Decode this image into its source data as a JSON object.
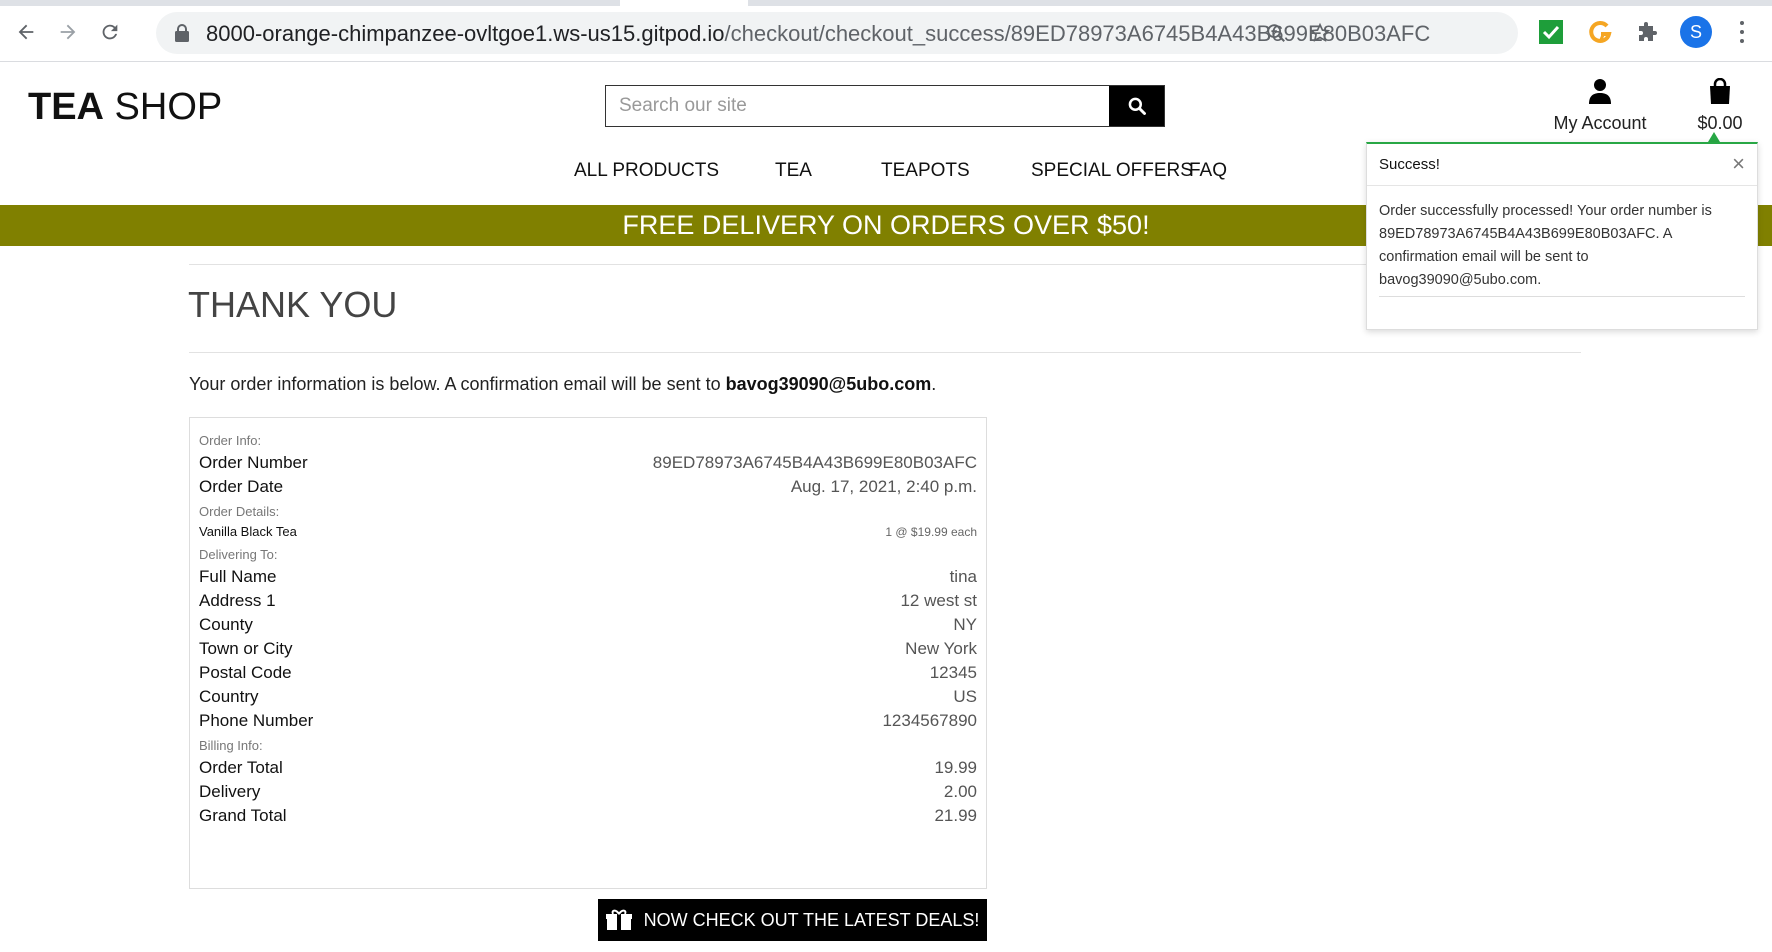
{
  "browser": {
    "url_host": "8000-orange-chimpanzee-ovltgoe1.ws-us15.gitpod.io",
    "url_path": "/checkout/checkout_success/89ED78973A6745B4A43B699E80B03AFC",
    "profile_initial": "S",
    "icons": [
      "back-icon",
      "forward-icon",
      "reload-icon",
      "lock-icon",
      "zoom-icon",
      "star-icon",
      "check-extension-icon",
      "grammarly-extension-icon",
      "puzzle-extension-icon",
      "more-icon"
    ]
  },
  "header": {
    "logo_bold": "TEA",
    "logo_rest": " SHOP",
    "search_placeholder": "Search our site",
    "account_label": "My Account",
    "bag_total": "$0.00"
  },
  "nav": {
    "items": [
      "ALL PRODUCTS",
      "TEA",
      "TEAPOTS",
      "SPECIAL OFFERS",
      "FAQ"
    ]
  },
  "banner": {
    "text": "FREE DELIVERY ON ORDERS OVER $50!",
    "color": "#808000"
  },
  "page": {
    "title": "THANK YOU",
    "intro_prefix": "Your order information is below. A confirmation email will be sent to ",
    "intro_email": "bavog39090@5ubo.com",
    "intro_suffix": "."
  },
  "order": {
    "info_label": "Order Info:",
    "number_label": "Order Number",
    "number": "89ED78973A6745B4A43B699E80B03AFC",
    "date_label": "Order Date",
    "date": "Aug. 17, 2021, 2:40 p.m.",
    "details_label": "Order Details:",
    "item_name": "Vanilla Black Tea",
    "item_qty": "1 @ $19.99 each",
    "delivering_label": "Delivering To:",
    "full_name_label": "Full Name",
    "full_name": "tina",
    "address1_label": "Address 1",
    "address1": "12 west st",
    "county_label": "County",
    "county": "NY",
    "town_label": "Town or City",
    "town": "New York",
    "postal_label": "Postal Code",
    "postal": "12345",
    "country_label": "Country",
    "country": "US",
    "phone_label": "Phone Number",
    "phone": "1234567890",
    "billing_label": "Billing Info:",
    "order_total_label": "Order Total",
    "order_total": "19.99",
    "delivery_label": "Delivery",
    "delivery": "2.00",
    "grand_total_label": "Grand Total",
    "grand_total": "21.99"
  },
  "deals_button": {
    "label": "NOW CHECK OUT THE LATEST DEALS!",
    "icon": "gift-icon"
  },
  "toast": {
    "title": "Success!",
    "close": "×",
    "message": "Order successfully processed! Your order number is 89ED78973A6745B4A43B699E80B03AFC. A confirmation email will be sent to bavog39090@5ubo.com.",
    "accent": "#28a745"
  }
}
